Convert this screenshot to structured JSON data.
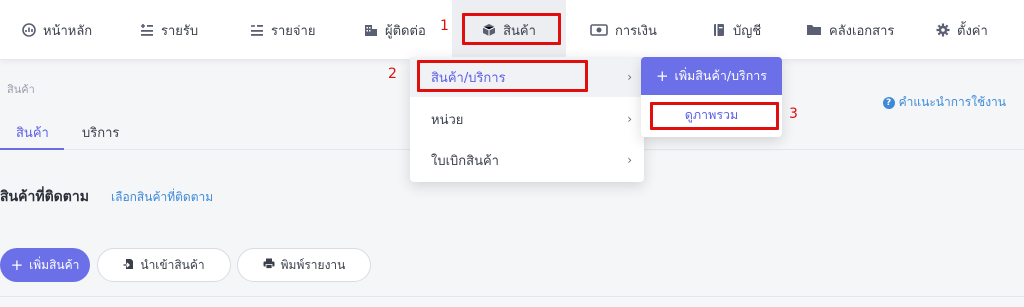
{
  "nav": {
    "items": [
      {
        "label": "หน้าหลัก",
        "icon": "dashboard-gauge-icon"
      },
      {
        "label": "รายรับ",
        "icon": "income-list-icon"
      },
      {
        "label": "รายจ่าย",
        "icon": "expense-list-icon"
      },
      {
        "label": "ผู้ติดต่อ",
        "icon": "contacts-building-icon"
      },
      {
        "label": "สินค้า",
        "icon": "product-box-icon"
      },
      {
        "label": "การเงิน",
        "icon": "money-icon"
      },
      {
        "label": "บัญชี",
        "icon": "ledger-book-icon"
      },
      {
        "label": "คลังเอกสาร",
        "icon": "folder-icon"
      },
      {
        "label": "ตั้งค่า",
        "icon": "gear-icon"
      }
    ],
    "active_index": 4
  },
  "annotations": {
    "step1": "1",
    "step2": "2",
    "step3": "3",
    "highlight_color": "#e10e0e"
  },
  "page": {
    "breadcrumb": "สินค้า",
    "help_link": "คำแนะนำการใช้งาน",
    "tabs": [
      "สินค้า",
      "บริการ"
    ],
    "active_tab": 0,
    "follow_title": "สินค้าที่ติดตาม",
    "follow_link": "เลือกสินค้าที่ติดตาม",
    "buttons": {
      "add": "เพิ่มสินค้า",
      "import": "นำเข้าสินค้า",
      "print": "พิมพ์รายงาน"
    }
  },
  "dropdown": {
    "items": [
      {
        "label": "สินค้า/บริการ"
      },
      {
        "label": "หน่วย"
      },
      {
        "label": "ใบเบิกสินค้า"
      }
    ],
    "submenu": {
      "add": "เพิ่มสินค้า/บริการ",
      "overview": "ดูภาพรวม"
    }
  },
  "colors": {
    "accent": "#6b6fe8",
    "link": "#3d8ad8",
    "highlight": "#e10e0e"
  }
}
